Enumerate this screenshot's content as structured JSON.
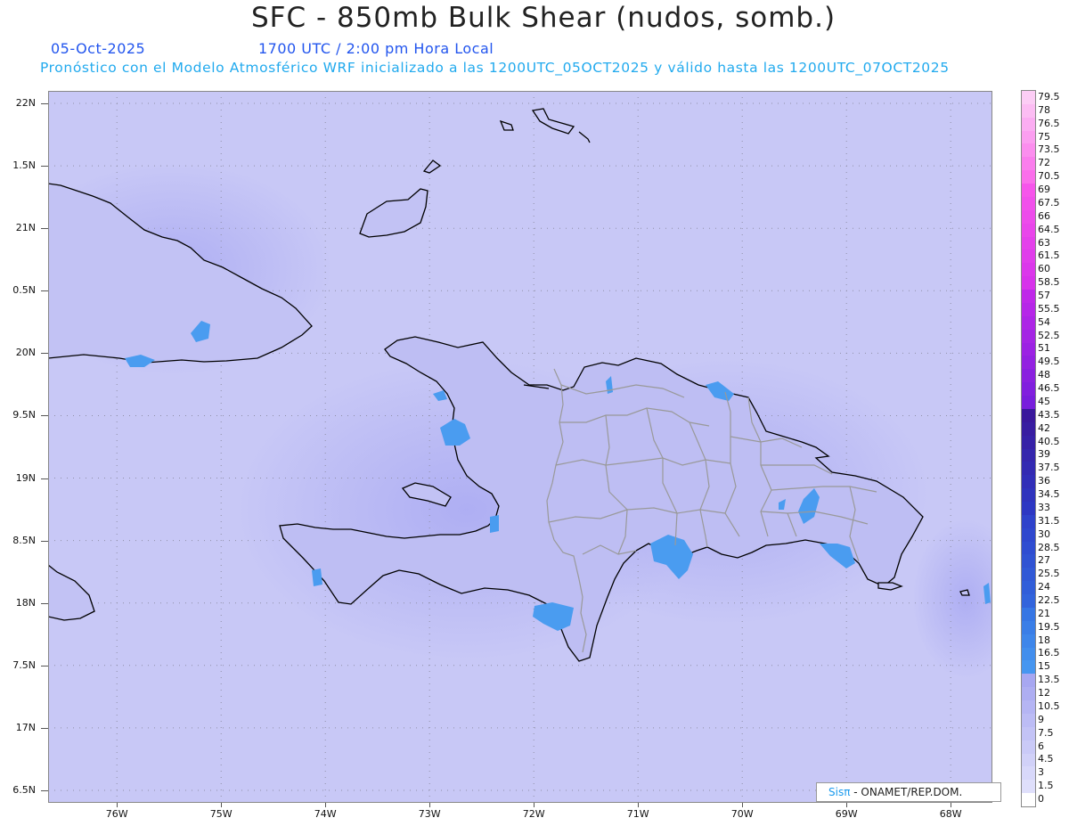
{
  "header": {
    "title": "SFC - 850mb Bulk Shear (nudos, somb.)",
    "date": "05-Oct-2025",
    "time": "1700 UTC / 2:00 pm Hora Local",
    "subtitle": "Pronóstico con el Modelo Atmosférico WRF inicializado a las 1200UTC_05OCT2025 y válido hasta las  1200UTC_07OCT2025"
  },
  "map": {
    "lat_range": [
      16.4,
      22.1
    ],
    "lon_range": [
      -76.66,
      -67.6
    ],
    "lat_labels": [
      "22N",
      "1.5N",
      "21N",
      "0.5N",
      "20N",
      "9.5N",
      "19N",
      "8.5N",
      "18N",
      "7.5N",
      "17N",
      "6.5N"
    ],
    "lat_values": [
      22.0,
      21.5,
      21.0,
      20.5,
      20.0,
      19.5,
      19.0,
      18.5,
      18.0,
      17.5,
      17.0,
      16.5
    ],
    "lon_labels": [
      "76W",
      "75W",
      "74W",
      "73W",
      "72W",
      "71W",
      "70W",
      "69W",
      "68W"
    ],
    "lon_values": [
      -76,
      -75,
      -74,
      -73,
      -72,
      -71,
      -70,
      -69,
      -68
    ],
    "background_color": "#c8c8f6",
    "coast_color": "#000000",
    "border_color": "#999999",
    "shear_blue_color": "#4a9cf0"
  },
  "colorbar": {
    "labels": [
      "79.5",
      "78",
      "76.5",
      "75",
      "73.5",
      "72",
      "70.5",
      "69",
      "67.5",
      "66",
      "64.5",
      "63",
      "61.5",
      "60",
      "58.5",
      "57",
      "55.5",
      "54",
      "52.5",
      "51",
      "49.5",
      "48",
      "46.5",
      "45",
      "43.5",
      "42",
      "40.5",
      "39",
      "37.5",
      "36",
      "34.5",
      "33",
      "31.5",
      "30",
      "28.5",
      "27",
      "25.5",
      "24",
      "22.5",
      "21",
      "19.5",
      "18",
      "16.5",
      "15",
      "13.5",
      "12",
      "10.5",
      "9",
      "7.5",
      "6",
      "4.5",
      "3",
      "1.5",
      "0"
    ]
  },
  "credit": {
    "sis": "Sisπ",
    "org": " - ONAMET/REP.DOM."
  }
}
